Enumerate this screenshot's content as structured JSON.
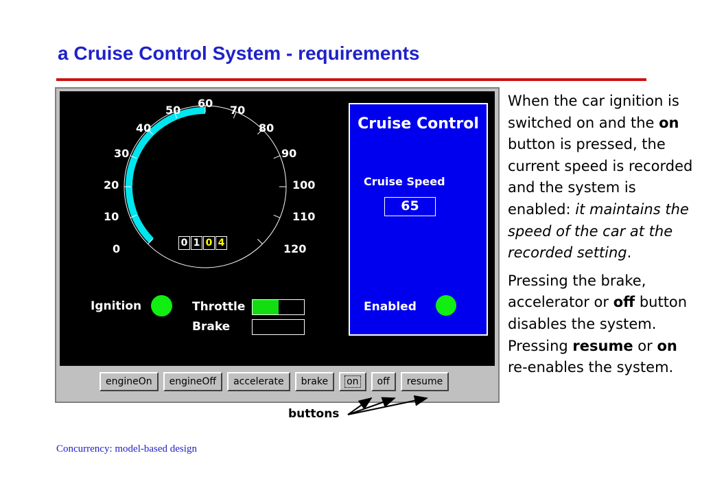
{
  "slide": {
    "title": "a Cruise Control System - requirements",
    "footer": "Concurrency: model-based design"
  },
  "speedometer": {
    "scale_labels": [
      "0",
      "10",
      "20",
      "30",
      "40",
      "50",
      "60",
      "70",
      "80",
      "90",
      "100",
      "110",
      "120"
    ],
    "speed_fraction": 0.5,
    "odometer_digits": [
      "0",
      "1",
      "0",
      "4"
    ],
    "arc_color": "#00e5ee"
  },
  "cruise_panel": {
    "title": "Cruise Control",
    "speed_label": "Cruise Speed",
    "speed_value": "65",
    "enabled_label": "Enabled",
    "enabled_color": "#11ee11",
    "background": "#0000ee"
  },
  "indicators": {
    "ignition_label": "Ignition",
    "throttle_label": "Throttle",
    "brake_label": "Brake",
    "throttle_level": 0.5,
    "brake_level": 0
  },
  "buttons": {
    "engine_on": "engineOn",
    "engine_off": "engineOff",
    "accelerate": "accelerate",
    "brake": "brake",
    "on": "on",
    "off": "off",
    "resume": "resume"
  },
  "callout": {
    "label": "buttons"
  },
  "description": {
    "p1_a": "When the car ignition is switched on and the ",
    "p1_on": "on",
    "p1_b": " button is pressed, the current speed is recorded and the system is enabled: ",
    "p1_italic": "it maintains the speed of the car at the recorded setting",
    "p1_end": ".",
    "p2_a": "Pressing the brake, accelerator or ",
    "p2_off": "off",
    "p2_b": " button disables the system. Pressing ",
    "p2_resume": "resume",
    "p2_c": " or ",
    "p2_on": "on",
    "p2_d": " re-enables the system."
  },
  "colors": {
    "title": "#1f22c8",
    "rule": "#cc1111"
  }
}
